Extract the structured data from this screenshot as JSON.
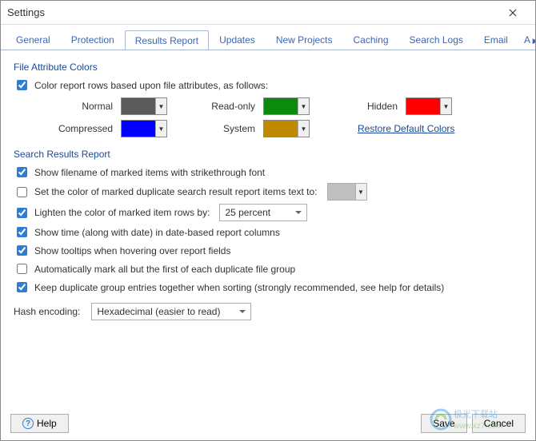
{
  "window": {
    "title": "Settings"
  },
  "tabs": {
    "items": [
      {
        "label": "General"
      },
      {
        "label": "Protection"
      },
      {
        "label": "Results Report"
      },
      {
        "label": "Updates"
      },
      {
        "label": "New Projects"
      },
      {
        "label": "Caching"
      },
      {
        "label": "Search Logs"
      },
      {
        "label": "Email"
      },
      {
        "label": "A"
      }
    ],
    "active_index": 2
  },
  "fileAttributeColors": {
    "heading": "File Attribute Colors",
    "master_checkbox_label": "Color report rows based upon file attributes, as follows:",
    "master_checked": true,
    "rows": {
      "normal_label": "Normal",
      "normal_color": "#5a5a5a",
      "readonly_label": "Read-only",
      "readonly_color": "#0b8a0b",
      "hidden_label": "Hidden",
      "hidden_color": "#ff0000",
      "compressed_label": "Compressed",
      "compressed_color": "#0000ff",
      "system_label": "System",
      "system_color": "#c08a00"
    },
    "restore_link": "Restore Default Colors"
  },
  "searchResultsReport": {
    "heading": "Search Results Report",
    "show_strikethrough": {
      "checked": true,
      "label": "Show filename of marked items with strikethrough font"
    },
    "set_marked_color": {
      "checked": false,
      "label": "Set the color of marked duplicate search result report items text to:"
    },
    "lighten_rows": {
      "checked": true,
      "label": "Lighten the color of marked item rows by:",
      "value": "25 percent"
    },
    "show_time": {
      "checked": true,
      "label": "Show time (along with date) in date-based report columns"
    },
    "show_tooltips": {
      "checked": true,
      "label": "Show tooltips when hovering over report fields"
    },
    "auto_mark": {
      "checked": false,
      "label": "Automatically mark all but the first of each duplicate file group"
    },
    "keep_grouped": {
      "checked": true,
      "label": "Keep duplicate group entries together when sorting (strongly recommended, see help for details)"
    }
  },
  "hash": {
    "label": "Hash encoding:",
    "value": "Hexadecimal (easier to read)"
  },
  "buttons": {
    "help": "Help",
    "save": "Save",
    "cancel": "Cancel"
  },
  "watermark": {
    "line1": "极光下载站",
    "line2": "www.xz7.com"
  }
}
